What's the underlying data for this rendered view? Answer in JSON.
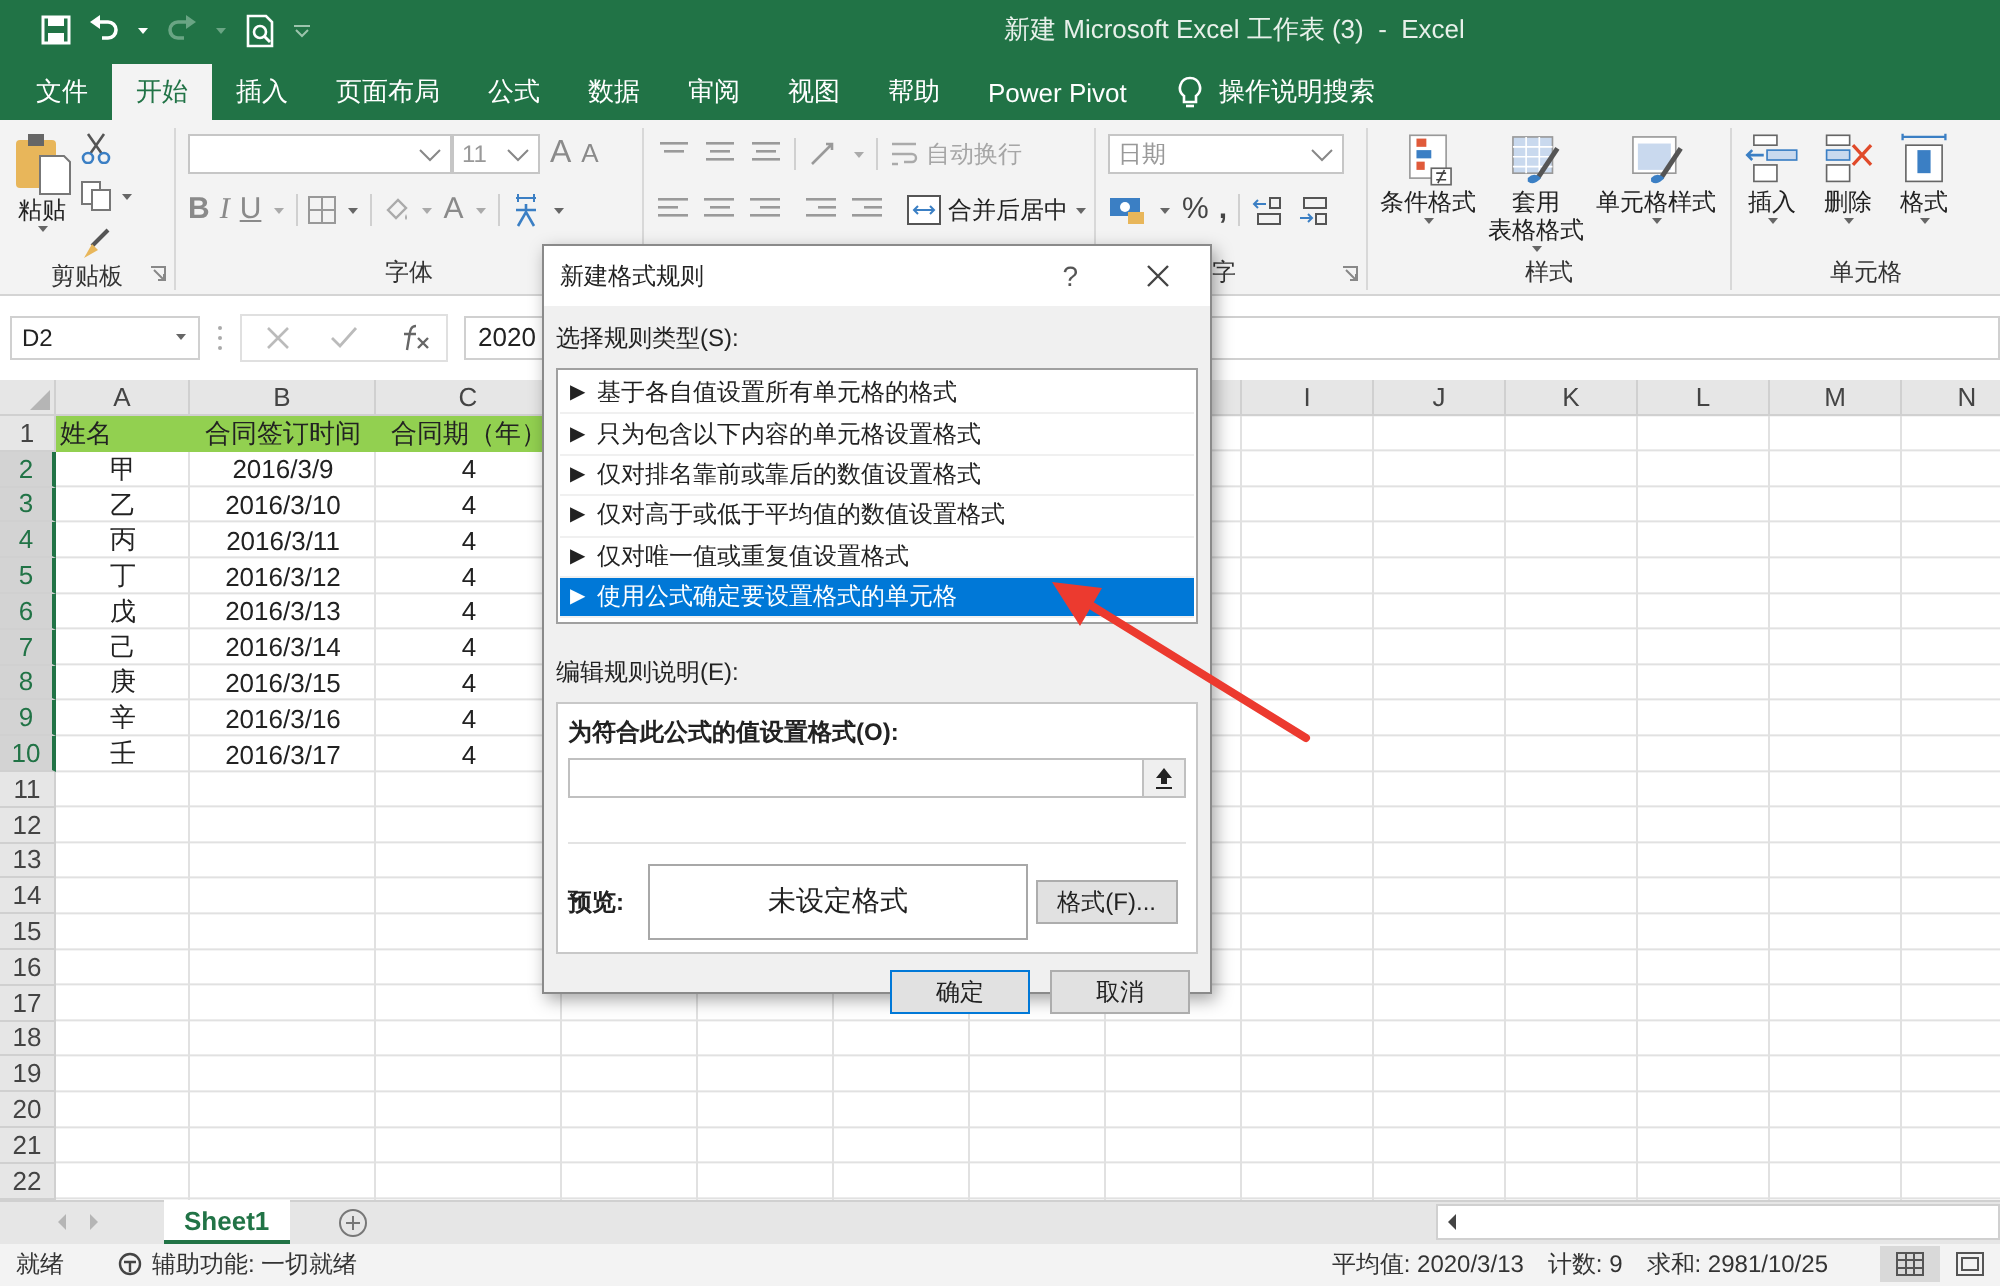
{
  "window": {
    "title": "新建 Microsoft Excel 工作表 (3)  -  Excel"
  },
  "tabs": [
    {
      "label": "文件",
      "selected": false
    },
    {
      "label": "开始",
      "selected": true
    },
    {
      "label": "插入",
      "selected": false
    },
    {
      "label": "页面布局",
      "selected": false
    },
    {
      "label": "公式",
      "selected": false
    },
    {
      "label": "数据",
      "selected": false
    },
    {
      "label": "审阅",
      "selected": false
    },
    {
      "label": "视图",
      "selected": false
    },
    {
      "label": "帮助",
      "selected": false
    },
    {
      "label": "Power Pivot",
      "selected": false
    }
  ],
  "tell_me": "操作说明搜索",
  "clipboard": {
    "label": "剪贴板",
    "paste": "粘贴"
  },
  "font": {
    "label": "字体",
    "size": "11",
    "grow": "A",
    "shrink": "A",
    "bold": "B",
    "italic": "I",
    "underline": "U",
    "font_color": "A"
  },
  "alignment": {
    "wrap_text": {
      "label": "自动换行",
      "disabled": true
    },
    "merge": {
      "label": "合并后居中",
      "disabled": false
    }
  },
  "number": {
    "label": "字",
    "format": "日期",
    "percent": "%",
    "comma": ","
  },
  "styles": {
    "label": "样式",
    "buttons": [
      {
        "lines": [
          "条件格式"
        ]
      },
      {
        "lines": [
          "套用",
          "表格格式"
        ]
      },
      {
        "lines": [
          "单元格样式"
        ]
      }
    ]
  },
  "cells": {
    "label": "单元格",
    "buttons": [
      {
        "lines": [
          "插入"
        ]
      },
      {
        "lines": [
          "删除"
        ]
      },
      {
        "lines": [
          "格式"
        ]
      }
    ]
  },
  "formula_bar": {
    "name_box": "D2",
    "formula": "2020"
  },
  "sheet": {
    "columns_left": [
      "A",
      "B",
      "C"
    ],
    "columns_right": [
      "I",
      "J",
      "K",
      "L",
      "M",
      "N"
    ],
    "rows": [
      {
        "number": "1",
        "kind": "header",
        "highlighted": false,
        "cells": [
          "姓名",
          "合同签订时间",
          "合同期（年）"
        ]
      },
      {
        "number": "2",
        "kind": "data",
        "highlighted": true,
        "cells": [
          "甲",
          "2016/3/9",
          "4"
        ]
      },
      {
        "number": "3",
        "kind": "data",
        "highlighted": true,
        "cells": [
          "乙",
          "2016/3/10",
          "4"
        ]
      },
      {
        "number": "4",
        "kind": "data",
        "highlighted": true,
        "cells": [
          "丙",
          "2016/3/11",
          "4"
        ]
      },
      {
        "number": "5",
        "kind": "data",
        "highlighted": true,
        "cells": [
          "丁",
          "2016/3/12",
          "4"
        ]
      },
      {
        "number": "6",
        "kind": "data",
        "highlighted": true,
        "cells": [
          "戊",
          "2016/3/13",
          "4"
        ]
      },
      {
        "number": "7",
        "kind": "data",
        "highlighted": true,
        "cells": [
          "己",
          "2016/3/14",
          "4"
        ]
      },
      {
        "number": "8",
        "kind": "data",
        "highlighted": true,
        "cells": [
          "庚",
          "2016/3/15",
          "4"
        ]
      },
      {
        "number": "9",
        "kind": "data",
        "highlighted": true,
        "cells": [
          "辛",
          "2016/3/16",
          "4"
        ]
      },
      {
        "number": "10",
        "kind": "data",
        "highlighted": true,
        "cells": [
          "壬",
          "2016/3/17",
          "4"
        ]
      },
      {
        "number": "11",
        "kind": "data",
        "highlighted": false
      },
      {
        "number": "12",
        "kind": "data",
        "highlighted": false
      },
      {
        "number": "13",
        "kind": "data",
        "highlighted": false
      },
      {
        "number": "14",
        "kind": "data",
        "highlighted": false
      },
      {
        "number": "15",
        "kind": "data",
        "highlighted": false
      },
      {
        "number": "16",
        "kind": "data",
        "highlighted": false
      },
      {
        "number": "17",
        "kind": "data",
        "highlighted": false
      },
      {
        "number": "18",
        "kind": "data",
        "highlighted": false
      },
      {
        "number": "19",
        "kind": "data",
        "highlighted": false
      },
      {
        "number": "20",
        "kind": "data",
        "highlighted": false
      },
      {
        "number": "21",
        "kind": "data",
        "highlighted": false
      },
      {
        "number": "22",
        "kind": "data",
        "highlighted": false
      }
    ]
  },
  "sheet_tabs": [
    {
      "label": "Sheet1",
      "selected": true
    }
  ],
  "status_bar": {
    "ready": "就绪",
    "accessibility": "辅助功能: 一切就绪",
    "average": "平均值: 2020/3/13",
    "count": "计数: 9",
    "sum": "求和: 2981/10/25"
  },
  "dialog": {
    "title": "新建格式规则",
    "help": "?",
    "rule_type_label": "选择规则类型(S):",
    "rule_types": [
      {
        "bullet": "▶",
        "label": "基于各自值设置所有单元格的格式",
        "selected": false
      },
      {
        "bullet": "▶",
        "label": "只为包含以下内容的单元格设置格式",
        "selected": false
      },
      {
        "bullet": "▶",
        "label": "仅对排名靠前或靠后的数值设置格式",
        "selected": false
      },
      {
        "bullet": "▶",
        "label": "仅对高于或低于平均值的数值设置格式",
        "selected": false
      },
      {
        "bullet": "▶",
        "label": "仅对唯一值或重复值设置格式",
        "selected": false
      },
      {
        "bullet": "▶",
        "label": "使用公式确定要设置格式的单元格",
        "selected": true
      }
    ],
    "edit_label": "编辑规则说明(E):",
    "formula_label": "为符合此公式的值设置格式(O):",
    "preview_label": "预览:",
    "preview_text": "未设定格式",
    "format_button": "格式(F)...",
    "ok": "确定",
    "cancel": "取消"
  }
}
